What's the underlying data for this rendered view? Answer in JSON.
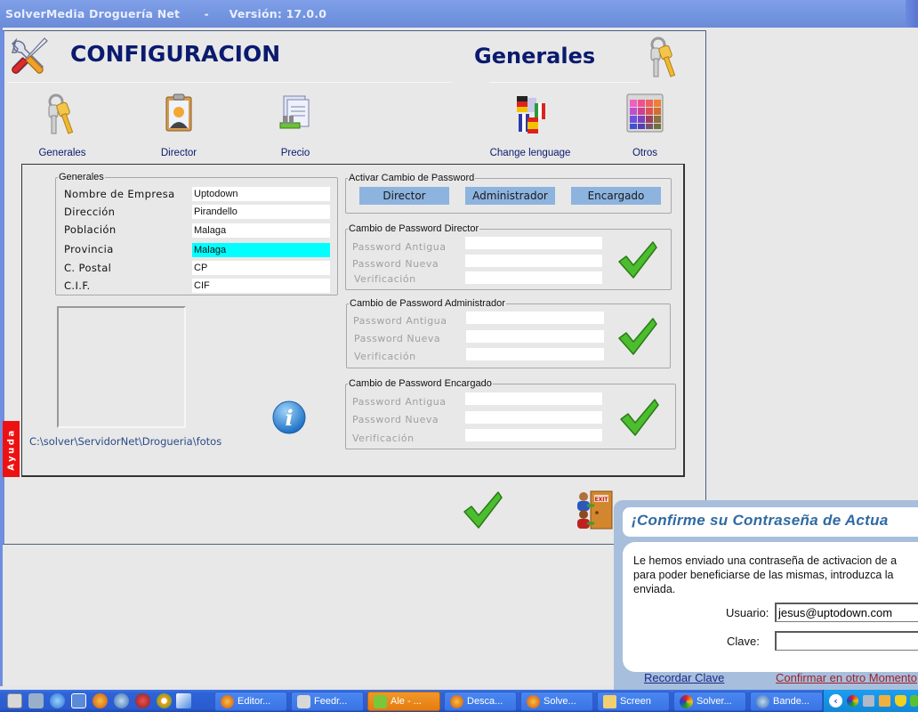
{
  "window": {
    "title": "SolverMedia Droguería Net      -     Versión: 17.0.0"
  },
  "header": {
    "title": "CONFIGURACION",
    "section_title": "Generales",
    "tools_icon": "wrench-screwdriver-icon",
    "section_icon": "keys-icon"
  },
  "nav": {
    "items": [
      {
        "label": "Generales",
        "icon": "keys-icon"
      },
      {
        "label": "Director",
        "icon": "clipboard-person-icon"
      },
      {
        "label": "Precio",
        "icon": "price-documents-icon"
      },
      {
        "label": "Change lenguage",
        "icon": "flags-icon"
      },
      {
        "label": "Otros",
        "icon": "color-palette-icon"
      }
    ]
  },
  "generales": {
    "legend": "Generales",
    "fields": [
      {
        "label": "Nombre de Empresa",
        "value": "Uptodown"
      },
      {
        "label": "Dirección",
        "value": "Pirandello"
      },
      {
        "label": "Población",
        "value": "Malaga"
      },
      {
        "label": "Provincia",
        "value": "Malaga"
      },
      {
        "label": "C. Postal",
        "value": "CP"
      },
      {
        "label": "C.I.F.",
        "value": "CIF"
      }
    ]
  },
  "photo": {
    "path": "C:\\solver\\ServidorNet\\Drogueria\\fotos"
  },
  "help_tab": "Ayuda",
  "activar": {
    "legend": "Activar Cambio de Password",
    "buttons": [
      "Director",
      "Administrador",
      "Encargado"
    ]
  },
  "password_groups": [
    {
      "legend": "Cambio de Password Director",
      "labels": [
        "Password Antigua",
        "Password Nueva",
        "Verificación"
      ]
    },
    {
      "legend": "Cambio de Password Administrador",
      "labels": [
        "Password Antigua",
        "Password Nueva",
        "Verificación"
      ]
    },
    {
      "legend": "Cambio de Password Encargado",
      "labels": [
        "Password Antigua",
        "Password Nueva",
        "Verificación"
      ]
    }
  ],
  "popup": {
    "title": "¡Confirme su Contraseña de Actua",
    "message_lines": [
      "Le hemos enviado una contraseña de activacion de a",
      "para poder beneficiarse de las mismas, introduzca la",
      "enviada."
    ],
    "usuario_label": "Usuario:",
    "usuario_value": "jesus@uptodown.com",
    "clave_label": "Clave:",
    "clave_value": "",
    "recordar_link": "Recordar Clave",
    "confirmar_link": "Confirmar en otro Momento",
    "colors": {
      "title": "#2f6aa3",
      "recordar": "#1a2a8a",
      "confirmar": "#a0202a"
    }
  },
  "taskbar": {
    "quick_launch": [
      "box-icon",
      "network-icon",
      "ie-icon",
      "outlook-icon",
      "firefox-icon",
      "thunderbird-icon",
      "music-icon",
      "media-player-icon",
      "plane-icon"
    ],
    "tasks": [
      {
        "label": "Editor...",
        "icon": "firefox-icon",
        "active": false
      },
      {
        "label": "Feedr...",
        "icon": "box-icon",
        "active": false
      },
      {
        "label": "Ale - ...",
        "icon": "messenger-icon",
        "active": true
      },
      {
        "label": "Desca...",
        "icon": "firefox-icon",
        "active": false
      },
      {
        "label": "Solve...",
        "icon": "firefox-icon",
        "active": false
      },
      {
        "label": "Screen",
        "icon": "folder-icon",
        "active": false
      },
      {
        "label": "Solver...",
        "icon": "solver-icon",
        "active": false
      },
      {
        "label": "Bande...",
        "icon": "thunderbird-icon",
        "active": false
      }
    ],
    "tray": [
      "chevron-left-icon",
      "solver-icon",
      "network-icon",
      "package-icon",
      "shield-icon",
      "messenger-icon"
    ]
  }
}
